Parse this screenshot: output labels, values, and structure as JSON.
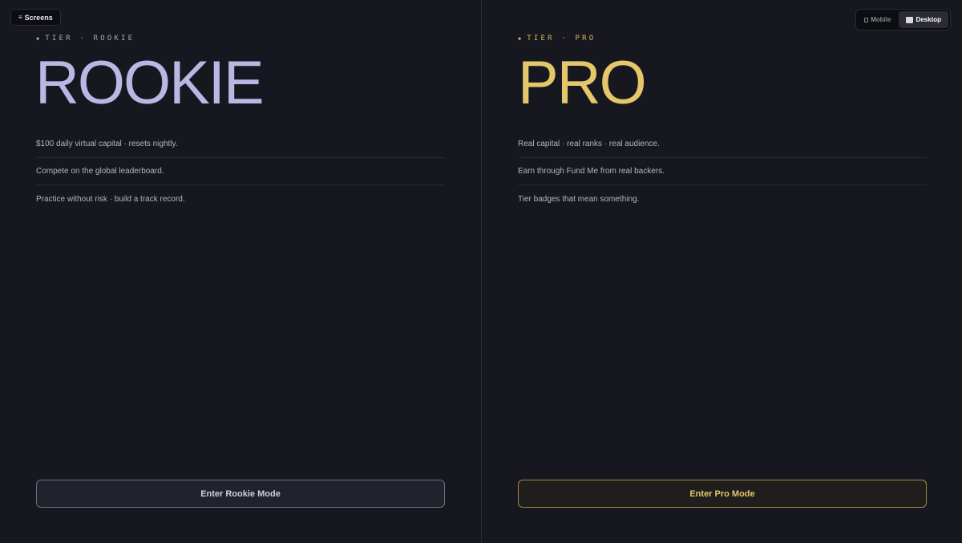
{
  "screens_button": {
    "icon": "menu-icon",
    "label": "Screens"
  },
  "view_toggle": {
    "options": [
      {
        "icon": "mobile-icon",
        "label": "Mobile",
        "active": false
      },
      {
        "icon": "desktop-icon",
        "label": "Desktop",
        "active": true
      }
    ]
  },
  "colors": {
    "background": "#17181f",
    "rookie_accent": "#b9b8e4",
    "pro_accent": "#e5c76b"
  },
  "rookie": {
    "tier_label": "TIER · ROOKIE",
    "title": "ROOKIE",
    "features": [
      "$100 daily virtual capital · resets nightly.",
      "Compete on the global leaderboard.",
      "Practice without risk · build a track record."
    ],
    "cta": "Enter Rookie Mode"
  },
  "pro": {
    "tier_label": "TIER · PRO",
    "title": "PRO",
    "features": [
      "Real capital · real ranks · real audience.",
      "Earn through Fund Me from real backers.",
      "Tier badges that mean something."
    ],
    "cta": "Enter Pro Mode"
  }
}
